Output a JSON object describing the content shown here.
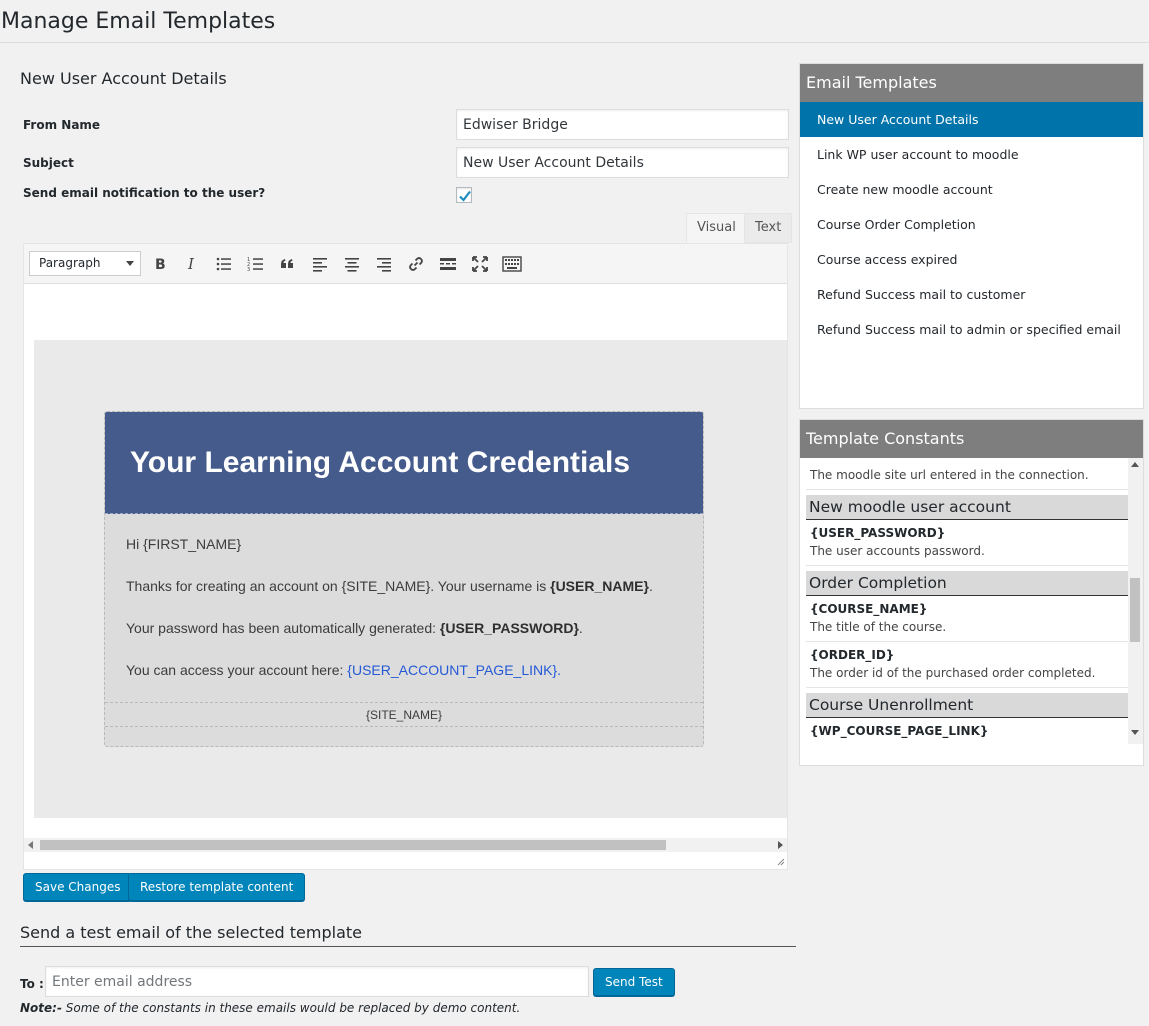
{
  "page": {
    "title": "Manage Email Templates"
  },
  "form": {
    "heading": "New User Account Details",
    "from_name_label": "From Name",
    "from_name_value": "Edwiser Bridge",
    "subject_label": "Subject",
    "subject_value": "New User Account Details",
    "notify_label": "Send email notification to the user?",
    "notify_checked": true
  },
  "editor": {
    "tabs": {
      "visual": "Visual",
      "text": "Text",
      "active": "Visual"
    },
    "format_select": "Paragraph",
    "toolbar_icons": [
      "bold-icon",
      "italic-icon",
      "bullet-list-icon",
      "numbered-list-icon",
      "blockquote-icon",
      "align-left-icon",
      "align-center-icon",
      "align-right-icon",
      "link-icon",
      "read-more-icon",
      "fullscreen-icon",
      "toolbar-toggle-icon"
    ],
    "colors": {
      "header_bg": "#445b8c",
      "card_bg": "#dcdcdc",
      "link": "#2459d6"
    }
  },
  "email": {
    "heading": "Your Learning Account Credentials",
    "greeting": "Hi {FIRST_NAME}",
    "line1_prefix": "Thanks for creating an account on {SITE_NAME}. Your username is ",
    "line1_bold": "{USER_NAME}",
    "line1_suffix": ".",
    "line2_prefix": "Your password has been automatically generated: ",
    "line2_bold": "{USER_PASSWORD}",
    "line2_suffix": ".",
    "line3_prefix": "You can access your account here: ",
    "line3_link": "{USER_ACCOUNT_PAGE_LINK}",
    "line3_suffix": ".",
    "footer": "{SITE_NAME}"
  },
  "actions": {
    "save": "Save Changes",
    "restore": "Restore template content"
  },
  "test_email": {
    "heading": "Send a test email of the selected template",
    "to_label": "To :",
    "placeholder": "Enter email address",
    "button": "Send Test",
    "note_prefix": "Note:-",
    "note_text": " Some of the constants in these emails would be replaced by demo content."
  },
  "templates_panel": {
    "title": "Email Templates",
    "items": [
      {
        "label": "New User Account Details",
        "active": true
      },
      {
        "label": "Link WP user account to moodle",
        "active": false
      },
      {
        "label": "Create new moodle account",
        "active": false
      },
      {
        "label": "Course Order Completion",
        "active": false
      },
      {
        "label": "Course access expired",
        "active": false
      },
      {
        "label": "Refund Success mail to customer",
        "active": false
      },
      {
        "label": "Refund Success mail to admin or specified email",
        "active": false
      }
    ]
  },
  "constants_panel": {
    "title": "Template Constants",
    "clipped_desc": "The moodle site url entered in the connection.",
    "groups": [
      {
        "title": "New moodle user account",
        "items": [
          {
            "name": "{USER_PASSWORD}",
            "desc": "The user accounts password."
          }
        ]
      },
      {
        "title": "Order Completion",
        "items": [
          {
            "name": "{COURSE_NAME}",
            "desc": "The title of the course."
          },
          {
            "name": "{ORDER_ID}",
            "desc": "The order id of the purchased order completed."
          }
        ]
      },
      {
        "title": "Course Unenrollment",
        "items": [
          {
            "name": "{WP_COURSE_PAGE_LINK}",
            "desc": ""
          }
        ]
      }
    ]
  }
}
